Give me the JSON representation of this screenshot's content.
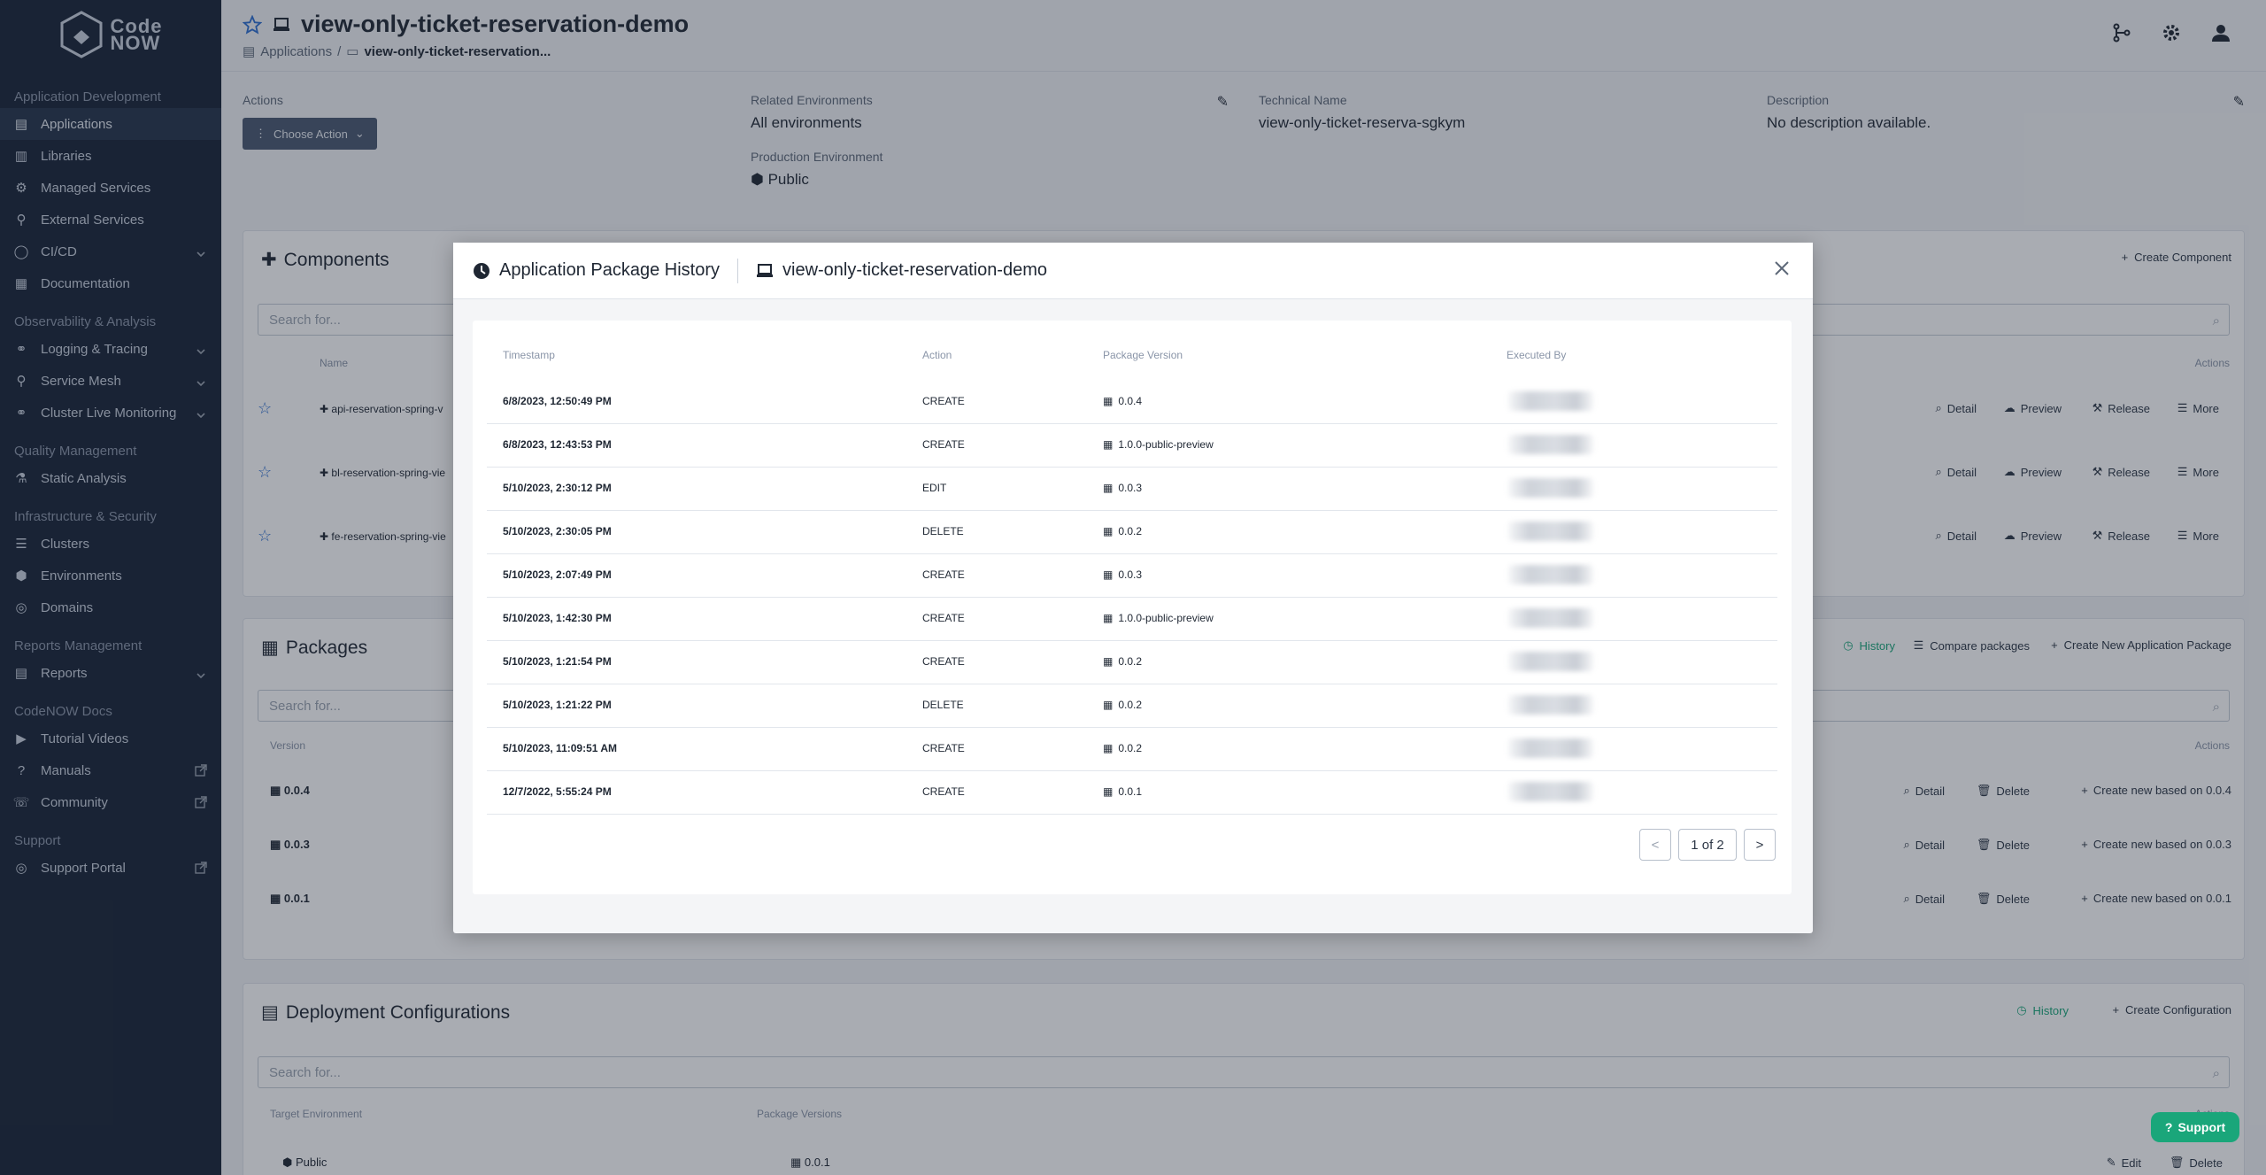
{
  "logo": {
    "line1": "Code",
    "line2": "NOW"
  },
  "sidebar": {
    "sections": [
      {
        "title": "Application Development",
        "items": [
          {
            "label": "Applications",
            "icon": "applications-icon",
            "active": true
          },
          {
            "label": "Libraries",
            "icon": "book-icon"
          },
          {
            "label": "Managed Services",
            "icon": "managed-services-icon"
          },
          {
            "label": "External Services",
            "icon": "external-services-icon"
          },
          {
            "label": "CI/CD",
            "icon": "cicd-icon",
            "caret": true
          },
          {
            "label": "Documentation",
            "icon": "documentation-icon"
          }
        ]
      },
      {
        "title": "Observability & Analysis",
        "items": [
          {
            "label": "Logging & Tracing",
            "icon": "binoculars-icon",
            "caret": true
          },
          {
            "label": "Service Mesh",
            "icon": "service-mesh-icon",
            "caret": true
          },
          {
            "label": "Cluster Live Monitoring",
            "icon": "binoculars-icon",
            "caret": true
          }
        ]
      },
      {
        "title": "Quality Management",
        "items": [
          {
            "label": "Static Analysis",
            "icon": "flask-icon"
          }
        ]
      },
      {
        "title": "Infrastructure & Security",
        "items": [
          {
            "label": "Clusters",
            "icon": "clusters-icon"
          },
          {
            "label": "Environments",
            "icon": "cube-icon"
          },
          {
            "label": "Domains",
            "icon": "globe-icon"
          }
        ]
      },
      {
        "title": "Reports Management",
        "items": [
          {
            "label": "Reports",
            "icon": "report-icon",
            "caret": true
          }
        ]
      },
      {
        "title": "CodeNOW Docs",
        "items": [
          {
            "label": "Tutorial Videos",
            "icon": "video-icon"
          },
          {
            "label": "Manuals",
            "icon": "question-icon",
            "external": true
          },
          {
            "label": "Community",
            "icon": "chat-icon",
            "external": true
          }
        ]
      },
      {
        "title": "Support",
        "items": [
          {
            "label": "Support Portal",
            "icon": "support-icon",
            "external": true
          }
        ]
      }
    ]
  },
  "header": {
    "title": "view-only-ticket-reservation-demo",
    "breadcrumb_root": "Applications",
    "breadcrumb_current": "view-only-ticket-reservation..."
  },
  "info": {
    "actions_label": "Actions",
    "choose_action": "Choose Action",
    "related_env_label": "Related Environments",
    "related_env_value": "All environments",
    "prod_env_label": "Production Environment",
    "prod_env_value": "Public",
    "tech_name_label": "Technical Name",
    "tech_name_value": "view-only-ticket-reserva-sgkym",
    "description_label": "Description",
    "description_value": "No description available."
  },
  "components": {
    "title": "Components",
    "create_label": "Create Component",
    "search_placeholder": "Search for...",
    "col_name": "Name",
    "col_actions": "Actions",
    "rows": [
      {
        "name": "api-reservation-spring-v"
      },
      {
        "name": "bl-reservation-spring-vie"
      },
      {
        "name": "fe-reservation-spring-vie"
      }
    ],
    "row_actions": {
      "detail": "Detail",
      "preview": "Preview",
      "release": "Release",
      "more": "More"
    }
  },
  "packages": {
    "title": "Packages",
    "history": "History",
    "compare": "Compare packages",
    "create_new": "Create New Application Package",
    "search_placeholder": "Search for...",
    "col_version": "Version",
    "col_actions": "Actions",
    "rows": [
      {
        "version": "0.0.4",
        "create_label": "Create new based on 0.0.4"
      },
      {
        "version": "0.0.3",
        "create_label": "Create new based on 0.0.3"
      },
      {
        "version": "0.0.1",
        "create_label": "Create new based on 0.0.1"
      }
    ],
    "detail": "Detail",
    "delete": "Delete"
  },
  "deploy": {
    "title": "Deployment Configurations",
    "history": "History",
    "create": "Create Configuration",
    "search_placeholder": "Search for...",
    "col_target": "Target Environment",
    "col_pkg": "Package Versions",
    "col_actions": "Actions",
    "row_env": "Public",
    "row_pkg": "0.0.1",
    "edit": "Edit",
    "delete": "Delete"
  },
  "modal": {
    "title": "Application Package History",
    "app_name": "view-only-ticket-reservation-demo",
    "col_timestamp": "Timestamp",
    "col_action": "Action",
    "col_version": "Package Version",
    "col_executed": "Executed By",
    "rows": [
      {
        "ts": "6/8/2023, 12:50:49 PM",
        "action": "CREATE",
        "version": "0.0.4"
      },
      {
        "ts": "6/8/2023, 12:43:53 PM",
        "action": "CREATE",
        "version": "1.0.0-public-preview"
      },
      {
        "ts": "5/10/2023, 2:30:12 PM",
        "action": "EDIT",
        "version": "0.0.3"
      },
      {
        "ts": "5/10/2023, 2:30:05 PM",
        "action": "DELETE",
        "version": "0.0.2"
      },
      {
        "ts": "5/10/2023, 2:07:49 PM",
        "action": "CREATE",
        "version": "0.0.3"
      },
      {
        "ts": "5/10/2023, 1:42:30 PM",
        "action": "CREATE",
        "version": "1.0.0-public-preview"
      },
      {
        "ts": "5/10/2023, 1:21:54 PM",
        "action": "CREATE",
        "version": "0.0.2"
      },
      {
        "ts": "5/10/2023, 1:21:22 PM",
        "action": "DELETE",
        "version": "0.0.2"
      },
      {
        "ts": "5/10/2023, 11:09:51 AM",
        "action": "CREATE",
        "version": "0.0.2"
      },
      {
        "ts": "12/7/2022, 5:55:24 PM",
        "action": "CREATE",
        "version": "0.0.1"
      }
    ],
    "pager": {
      "prev": "<",
      "page": "1 of 2",
      "next": ">"
    }
  },
  "support_button": "Support",
  "colors": {
    "sidebar": "#172236",
    "accent": "#1aa67a",
    "dark_button": "#4a5770"
  }
}
